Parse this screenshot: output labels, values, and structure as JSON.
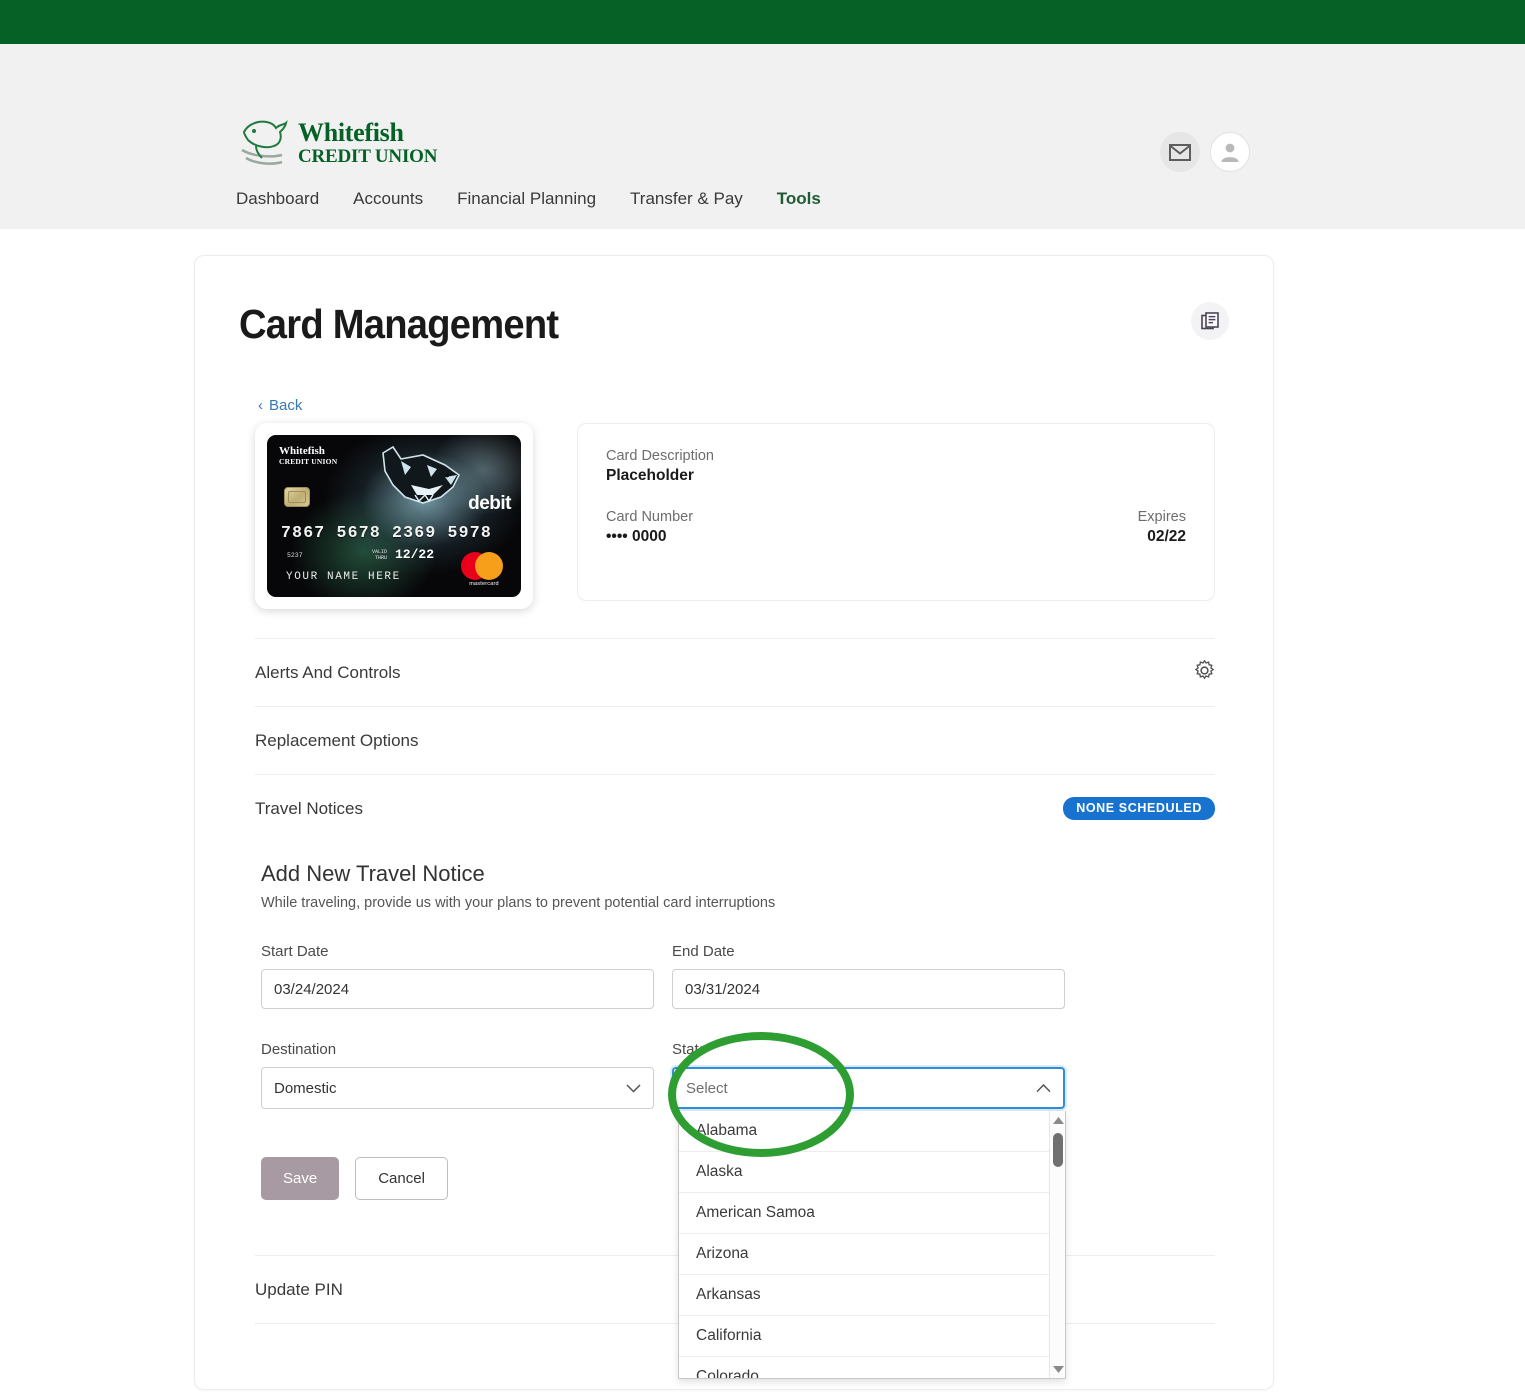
{
  "brand": {
    "name_line1": "Whitefish",
    "name_line2": "CREDIT UNION",
    "green": "#056125"
  },
  "header": {
    "mail_icon": "mail-icon",
    "avatar_icon": "user-avatar-icon",
    "nav": [
      {
        "label": "Dashboard",
        "active": false
      },
      {
        "label": "Accounts",
        "active": false
      },
      {
        "label": "Financial Planning",
        "active": false
      },
      {
        "label": "Transfer & Pay",
        "active": false
      },
      {
        "label": "Tools",
        "active": true
      }
    ]
  },
  "page": {
    "title": "Card Management",
    "doc_icon": "documents-icon",
    "back_label": "Back",
    "back_chevron": "‹"
  },
  "card_art": {
    "logo_line1": "Whitefish",
    "logo_line2": "CREDIT UNION",
    "debit_label": "debit",
    "number": "7867 5678 2369 5978",
    "small_code": "5237",
    "valid_line1": "VALID",
    "valid_line2": "THRU",
    "expiry": "12/22",
    "holder_name": "YOUR NAME HERE",
    "network": "mastercard"
  },
  "card_details": {
    "description_label": "Card Description",
    "description_value": "Placeholder",
    "number_label": "Card Number",
    "number_value": "•••• 0000",
    "expires_label": "Expires",
    "expires_value": "02/22"
  },
  "sections": [
    {
      "label": "Alerts And Controls",
      "icon": "gear-icon",
      "badge": null
    },
    {
      "label": "Replacement Options",
      "icon": null,
      "badge": null
    },
    {
      "label": "Travel Notices",
      "icon": null,
      "badge": "NONE  SCHEDULED"
    },
    {
      "label": "Update PIN",
      "icon": null,
      "badge": null
    }
  ],
  "badge_color": "#1773cf",
  "travel_form": {
    "title": "Add New Travel Notice",
    "subtitle": "While traveling, provide us with your plans to prevent potential card interruptions",
    "start_date_label": "Start Date",
    "start_date_value": "03/24/2024",
    "end_date_label": "End Date",
    "end_date_value": "03/31/2024",
    "destination_label": "Destination",
    "destination_value": "Domestic",
    "state_label": "State",
    "state_placeholder": "Select",
    "save_label": "Save",
    "cancel_label": "Cancel"
  },
  "state_dropdown": {
    "open": true,
    "options": [
      "Alabama",
      "Alaska",
      "American Samoa",
      "Arizona",
      "Arkansas",
      "California",
      "Colorado"
    ]
  },
  "annotation": {
    "shape": "ellipse",
    "color": "#2f9e32",
    "target": "state-select"
  }
}
